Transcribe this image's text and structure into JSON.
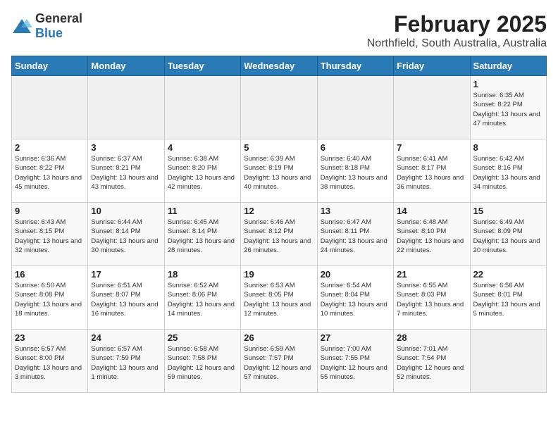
{
  "logo": {
    "general": "General",
    "blue": "Blue"
  },
  "title": "February 2025",
  "subtitle": "Northfield, South Australia, Australia",
  "days_of_week": [
    "Sunday",
    "Monday",
    "Tuesday",
    "Wednesday",
    "Thursday",
    "Friday",
    "Saturday"
  ],
  "weeks": [
    [
      {
        "day": "",
        "info": ""
      },
      {
        "day": "",
        "info": ""
      },
      {
        "day": "",
        "info": ""
      },
      {
        "day": "",
        "info": ""
      },
      {
        "day": "",
        "info": ""
      },
      {
        "day": "",
        "info": ""
      },
      {
        "day": "1",
        "info": "Sunrise: 6:35 AM\nSunset: 8:22 PM\nDaylight: 13 hours and 47 minutes."
      }
    ],
    [
      {
        "day": "2",
        "info": "Sunrise: 6:36 AM\nSunset: 8:22 PM\nDaylight: 13 hours and 45 minutes."
      },
      {
        "day": "3",
        "info": "Sunrise: 6:37 AM\nSunset: 8:21 PM\nDaylight: 13 hours and 43 minutes."
      },
      {
        "day": "4",
        "info": "Sunrise: 6:38 AM\nSunset: 8:20 PM\nDaylight: 13 hours and 42 minutes."
      },
      {
        "day": "5",
        "info": "Sunrise: 6:39 AM\nSunset: 8:19 PM\nDaylight: 13 hours and 40 minutes."
      },
      {
        "day": "6",
        "info": "Sunrise: 6:40 AM\nSunset: 8:18 PM\nDaylight: 13 hours and 38 minutes."
      },
      {
        "day": "7",
        "info": "Sunrise: 6:41 AM\nSunset: 8:17 PM\nDaylight: 13 hours and 36 minutes."
      },
      {
        "day": "8",
        "info": "Sunrise: 6:42 AM\nSunset: 8:16 PM\nDaylight: 13 hours and 34 minutes."
      }
    ],
    [
      {
        "day": "9",
        "info": "Sunrise: 6:43 AM\nSunset: 8:15 PM\nDaylight: 13 hours and 32 minutes."
      },
      {
        "day": "10",
        "info": "Sunrise: 6:44 AM\nSunset: 8:14 PM\nDaylight: 13 hours and 30 minutes."
      },
      {
        "day": "11",
        "info": "Sunrise: 6:45 AM\nSunset: 8:14 PM\nDaylight: 13 hours and 28 minutes."
      },
      {
        "day": "12",
        "info": "Sunrise: 6:46 AM\nSunset: 8:12 PM\nDaylight: 13 hours and 26 minutes."
      },
      {
        "day": "13",
        "info": "Sunrise: 6:47 AM\nSunset: 8:11 PM\nDaylight: 13 hours and 24 minutes."
      },
      {
        "day": "14",
        "info": "Sunrise: 6:48 AM\nSunset: 8:10 PM\nDaylight: 13 hours and 22 minutes."
      },
      {
        "day": "15",
        "info": "Sunrise: 6:49 AM\nSunset: 8:09 PM\nDaylight: 13 hours and 20 minutes."
      }
    ],
    [
      {
        "day": "16",
        "info": "Sunrise: 6:50 AM\nSunset: 8:08 PM\nDaylight: 13 hours and 18 minutes."
      },
      {
        "day": "17",
        "info": "Sunrise: 6:51 AM\nSunset: 8:07 PM\nDaylight: 13 hours and 16 minutes."
      },
      {
        "day": "18",
        "info": "Sunrise: 6:52 AM\nSunset: 8:06 PM\nDaylight: 13 hours and 14 minutes."
      },
      {
        "day": "19",
        "info": "Sunrise: 6:53 AM\nSunset: 8:05 PM\nDaylight: 13 hours and 12 minutes."
      },
      {
        "day": "20",
        "info": "Sunrise: 6:54 AM\nSunset: 8:04 PM\nDaylight: 13 hours and 10 minutes."
      },
      {
        "day": "21",
        "info": "Sunrise: 6:55 AM\nSunset: 8:03 PM\nDaylight: 13 hours and 7 minutes."
      },
      {
        "day": "22",
        "info": "Sunrise: 6:56 AM\nSunset: 8:01 PM\nDaylight: 13 hours and 5 minutes."
      }
    ],
    [
      {
        "day": "23",
        "info": "Sunrise: 6:57 AM\nSunset: 8:00 PM\nDaylight: 13 hours and 3 minutes."
      },
      {
        "day": "24",
        "info": "Sunrise: 6:57 AM\nSunset: 7:59 PM\nDaylight: 13 hours and 1 minute."
      },
      {
        "day": "25",
        "info": "Sunrise: 6:58 AM\nSunset: 7:58 PM\nDaylight: 12 hours and 59 minutes."
      },
      {
        "day": "26",
        "info": "Sunrise: 6:59 AM\nSunset: 7:57 PM\nDaylight: 12 hours and 57 minutes."
      },
      {
        "day": "27",
        "info": "Sunrise: 7:00 AM\nSunset: 7:55 PM\nDaylight: 12 hours and 55 minutes."
      },
      {
        "day": "28",
        "info": "Sunrise: 7:01 AM\nSunset: 7:54 PM\nDaylight: 12 hours and 52 minutes."
      },
      {
        "day": "",
        "info": ""
      }
    ]
  ]
}
